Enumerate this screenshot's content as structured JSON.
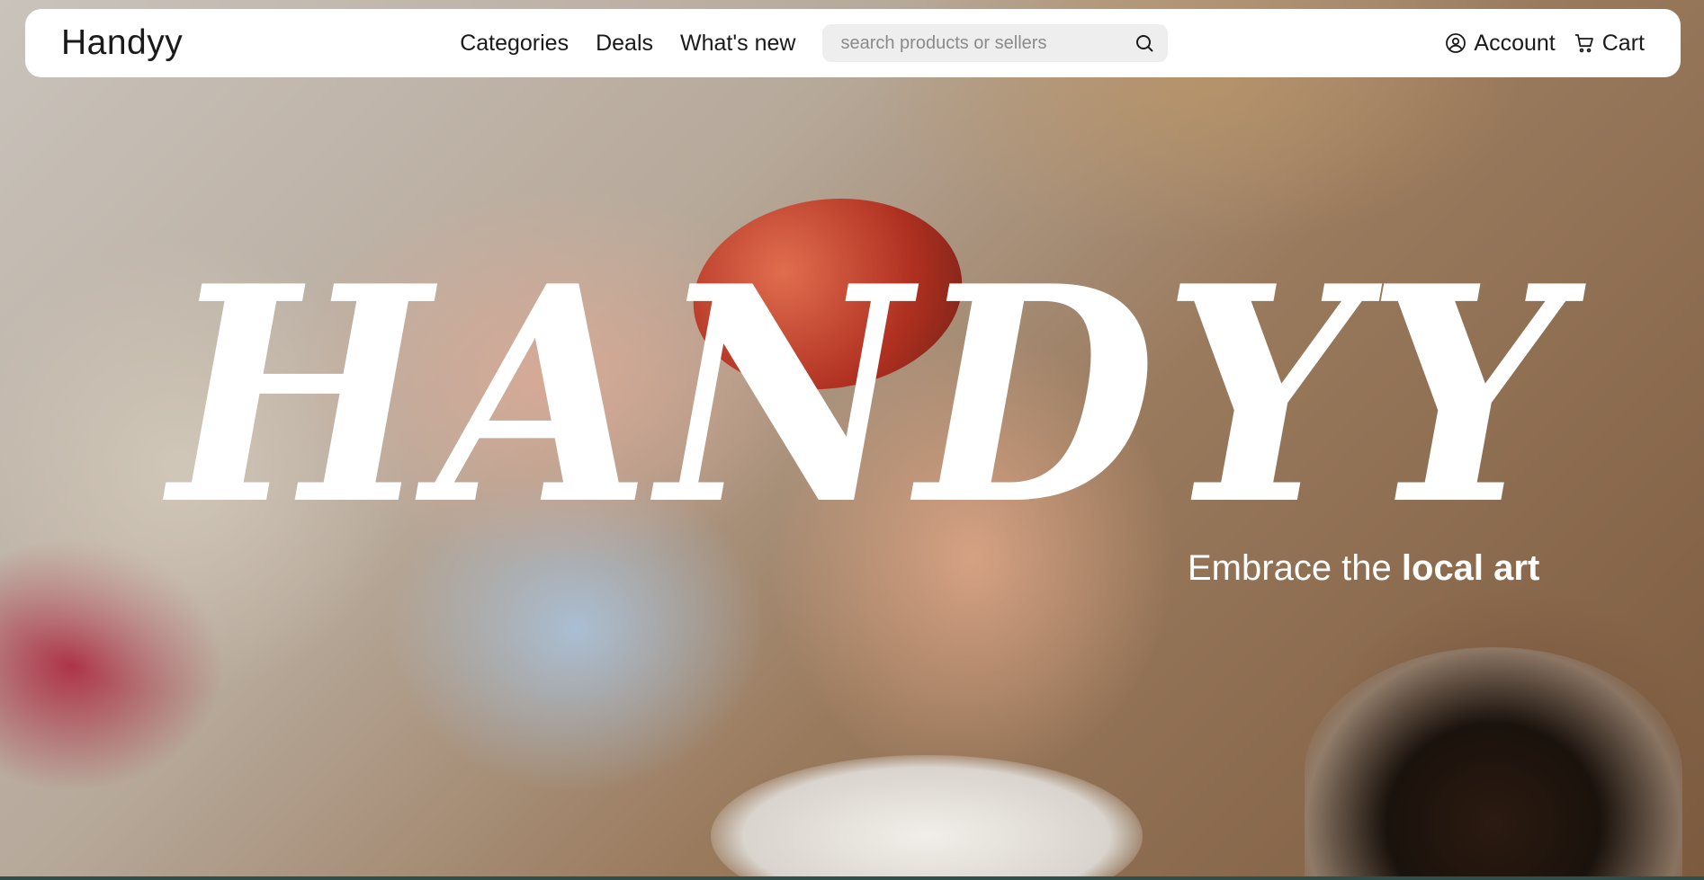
{
  "brand": "Handyy",
  "nav": {
    "links": [
      "Categories",
      "Deals",
      "What's new"
    ],
    "search_placeholder": "search products or sellers",
    "search_icon": "search-icon",
    "account_label": "Account",
    "account_icon": "user-circle-icon",
    "cart_label": "Cart",
    "cart_icon": "cart-icon"
  },
  "hero": {
    "title": "HANDYY",
    "tagline_prefix": "Embrace the ",
    "tagline_emphasis": "local art"
  },
  "colors": {
    "navbar_bg": "#ffffff",
    "search_bg": "#eeeeee",
    "text": "#1a1a1a",
    "hero_text": "#ffffff"
  }
}
